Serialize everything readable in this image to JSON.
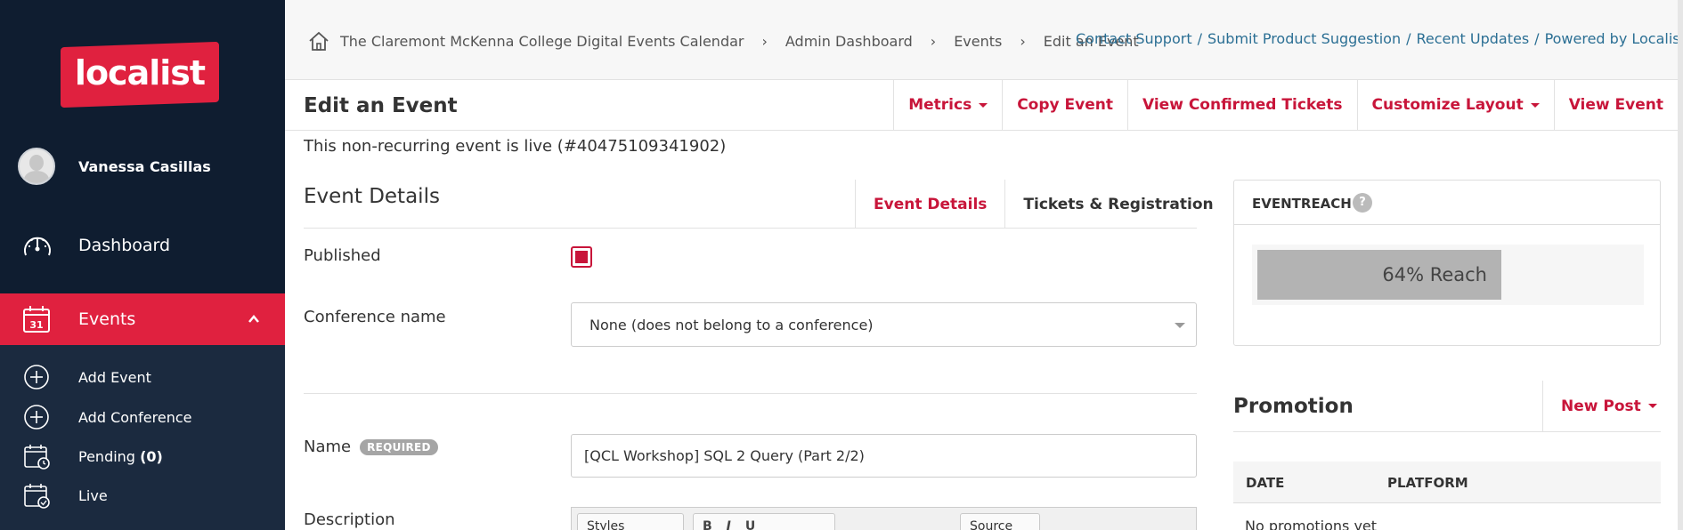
{
  "sidebar": {
    "logo": "localist",
    "user_name": "Vanessa Casillas",
    "dashboard_label": "Dashboard",
    "events_label": "Events",
    "sub_items": [
      {
        "label": "Add Event",
        "icon": "plus-circle-icon"
      },
      {
        "label": "Add Conference",
        "icon": "plus-circle-icon"
      },
      {
        "label": "Pending",
        "count": "(0)",
        "icon": "calendar-clock-icon"
      },
      {
        "label": "Live",
        "icon": "calendar-check-icon"
      }
    ]
  },
  "breadcrumb": {
    "items": [
      "The Claremont McKenna College Digital Events Calendar",
      "Admin Dashboard",
      "Events",
      "Edit an Event"
    ],
    "separator": "›"
  },
  "top_links": [
    "Contact Support",
    "Submit Product Suggestion",
    "Recent Updates",
    "Powered by Localist ®"
  ],
  "page": {
    "title": "Edit an Event",
    "actions": [
      {
        "label": "Metrics",
        "dropdown": true
      },
      {
        "label": "Copy Event",
        "dropdown": false
      },
      {
        "label": "View Confirmed Tickets",
        "dropdown": false
      },
      {
        "label": "Customize Layout",
        "dropdown": true
      },
      {
        "label": "View Event",
        "dropdown": false
      }
    ],
    "status_text": "This non-recurring event is live (#40475109341902)"
  },
  "details": {
    "section_title": "Event Details",
    "tabs": [
      {
        "label": "Event Details",
        "active": true
      },
      {
        "label": "Tickets & Registration",
        "active": false
      }
    ],
    "published_label": "Published",
    "published_checked": true,
    "conference_label": "Conference name",
    "conference_value": "None (does not belong to a conference)",
    "name_label": "Name",
    "required_badge": "REQUIRED",
    "name_value": "[QCL Workshop] SQL  2 Query (Part 2/2)",
    "description_label": "Description",
    "editor": {
      "styles_label": "Styles",
      "buttons": [
        "B",
        "I",
        "U"
      ],
      "source_label": "Source"
    }
  },
  "eventreach": {
    "title": "EVENTREACH",
    "help": "?",
    "percent": 64,
    "label": "64% Reach"
  },
  "promotion": {
    "title": "Promotion",
    "new_post_label": "New Post",
    "columns": [
      "DATE",
      "PLATFORM"
    ],
    "empty_text": "No promotions yet"
  },
  "colors": {
    "sidebar_bg": "#0f1d30",
    "accent": "#e0213f",
    "link": "#2b6f94"
  }
}
